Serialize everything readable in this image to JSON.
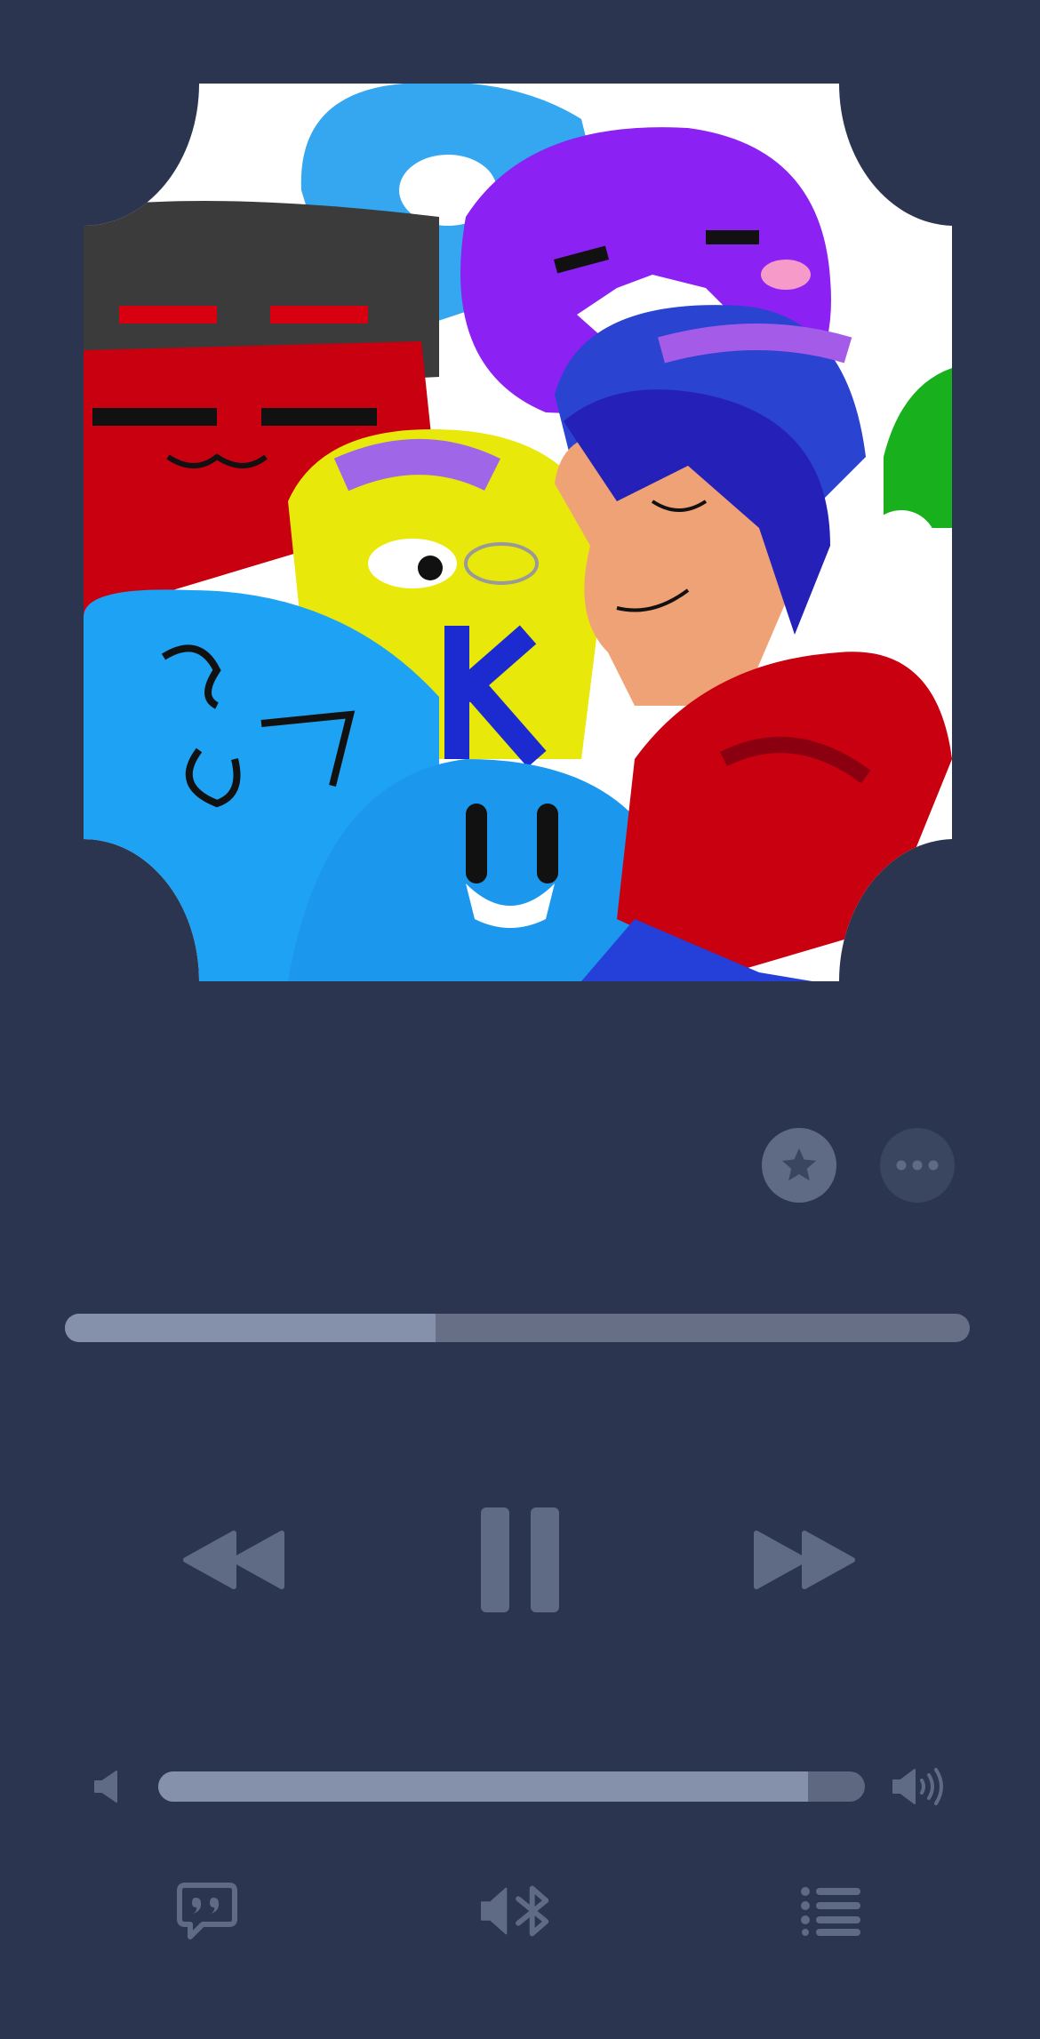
{
  "player": {
    "progress_fraction": 0.41,
    "volume_fraction": 0.92
  },
  "icons": {
    "favorite": "star-icon",
    "more": "more-icon",
    "rewind": "rewind-icon",
    "pause": "pause-icon",
    "forward": "fast-forward-icon",
    "volume_low": "speaker-low-icon",
    "volume_high": "speaker-high-icon",
    "lyrics": "lyrics-quote-icon",
    "output": "bluetooth-speaker-icon",
    "queue": "queue-list-icon"
  },
  "colors": {
    "background": "#2b3550",
    "control": "#666f85",
    "fill": "#8590aa"
  }
}
